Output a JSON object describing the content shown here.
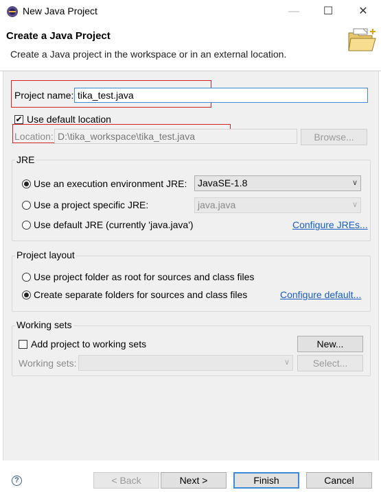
{
  "window": {
    "title": "New Java Project"
  },
  "header": {
    "title": "Create a Java Project",
    "subtitle": "Create a Java project in the workspace or in an external location."
  },
  "project": {
    "name_label": "Project name:",
    "name_value": "tika_test.java",
    "use_default_location_label": "Use default location",
    "use_default_location_checked": true,
    "location_label": "Location:",
    "location_value": "D:\\tika_workspace\\tika_test.java",
    "browse_label": "Browse..."
  },
  "jre": {
    "group_label": "JRE",
    "options": [
      {
        "label": "Use an execution environment JRE:",
        "checked": true
      },
      {
        "label": "Use a project specific JRE:",
        "checked": false
      },
      {
        "label": "Use default JRE (currently 'java.java')",
        "checked": false
      }
    ],
    "execution_env_value": "JavaSE-1.8",
    "project_specific_value": "java.java",
    "configure_link": "Configure JREs..."
  },
  "layout": {
    "group_label": "Project layout",
    "options": [
      {
        "label": "Use project folder as root for sources and class files",
        "checked": false
      },
      {
        "label": "Create separate folders for sources and class files",
        "checked": true
      }
    ],
    "configure_link": "Configure default..."
  },
  "working_sets": {
    "group_label": "Working sets",
    "add_label": "Add project to working sets",
    "add_checked": false,
    "new_label": "New...",
    "sets_label": "Working sets:",
    "sets_value": "",
    "select_label": "Select..."
  },
  "footer": {
    "help_glyph": "?",
    "back_label": "< Back",
    "next_label": "Next >",
    "finish_label": "Finish",
    "cancel_label": "Cancel"
  },
  "window_controls": {
    "minimize": "—",
    "maximize": "☐",
    "close": "✕"
  }
}
